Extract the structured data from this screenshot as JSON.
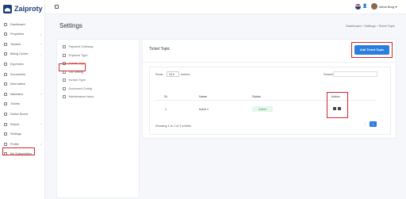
{
  "app": {
    "logo_text": "Zaiproty"
  },
  "header": {
    "user_name": "Alexs Burg"
  },
  "sidebar": {
    "items": [
      {
        "label": "Dashboard",
        "icon": "home-icon",
        "chevron": false
      },
      {
        "label": "Properties",
        "icon": "building-icon",
        "chevron": true
      },
      {
        "label": "Tenants",
        "icon": "users-icon",
        "chevron": true
      },
      {
        "label": "Billing Center",
        "icon": "bill-icon",
        "chevron": true
      },
      {
        "label": "Expenses",
        "icon": "wallet-icon",
        "chevron": false
      },
      {
        "label": "Documents",
        "icon": "document-icon",
        "chevron": false
      },
      {
        "label": "Information",
        "icon": "info-icon",
        "chevron": false
      },
      {
        "label": "Maintains",
        "icon": "tools-icon",
        "chevron": true
      },
      {
        "label": "Tickets",
        "icon": "ticket-icon",
        "chevron": false
      },
      {
        "label": "Notice Board",
        "icon": "board-icon",
        "chevron": false
      },
      {
        "label": "Report",
        "icon": "report-icon",
        "chevron": true
      },
      {
        "label": "Settings",
        "icon": "gear-icon",
        "chevron": false
      },
      {
        "label": "Profile",
        "icon": "user-icon",
        "chevron": true
      },
      {
        "label": "My Subscription",
        "icon": "subscription-icon",
        "chevron": false
      }
    ]
  },
  "page": {
    "title": "Settings",
    "breadcrumb": "Dashboard  ›  Settings  ›  Ticket Topic"
  },
  "settings_menu": {
    "items": [
      {
        "label": "Payment Gateway"
      },
      {
        "label": "Expense Type"
      },
      {
        "label": "Tickets Topic"
      },
      {
        "label": "Tax Setting"
      },
      {
        "label": "Invoice Type"
      },
      {
        "label": "Document Config"
      },
      {
        "label": "Maintenance Issue"
      }
    ],
    "active_index": 2
  },
  "ticket_topic": {
    "card_title": "Ticket Topic",
    "add_button": "Add Ticket Topic",
    "show_label": "Show",
    "show_value": "10",
    "entries_label": "entries",
    "search_label": "Search:",
    "columns": [
      "SL",
      "Name",
      "Status",
      "Action"
    ],
    "rows": [
      {
        "sl": "1",
        "name": "ticket 1",
        "status": "Active"
      }
    ],
    "footer": "Showing 1 to 1 of 1 entries",
    "page": "1",
    "prev_symbol": "‹"
  },
  "colors": {
    "accent": "#2a7fe0",
    "highlight": "#d9262c",
    "active_status": "#31a35a",
    "brand": "#1d3f7a"
  }
}
